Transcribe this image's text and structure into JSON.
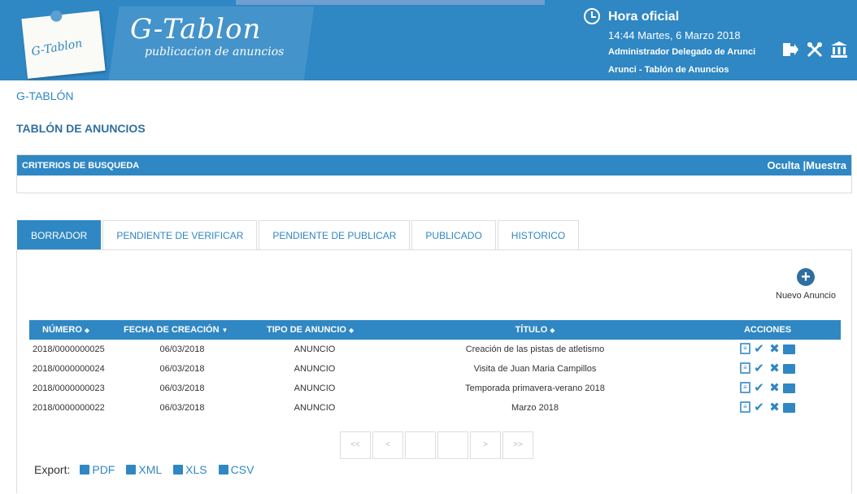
{
  "header": {
    "logo_text": "G-Tablon",
    "brand_title": "G-Tablon",
    "brand_subtitle": "publicacion de anuncios",
    "hora_title": "Hora oficial",
    "hora_time": "14:44 Martes, 6 Marzo 2018",
    "user": "Administrador Delegado de Arunci",
    "organization": "Arunci - Tablón de Anuncios",
    "icons": [
      "logout-icon",
      "tools-icon",
      "institution-icon"
    ]
  },
  "breadcrumb": "G-TABLÓN",
  "page_title": "TABLÓN DE ANUNCIOS",
  "criteria": {
    "label": "CRITERIOS DE BUSQUEDA",
    "toggle": "Oculta |Muestra"
  },
  "tabs": [
    {
      "label": "BORRADOR",
      "active": true
    },
    {
      "label": "PENDIENTE DE VERIFICAR",
      "active": false
    },
    {
      "label": "PENDIENTE DE PUBLICAR",
      "active": false
    },
    {
      "label": "PUBLICADO",
      "active": false
    },
    {
      "label": "HISTORICO",
      "active": false
    }
  ],
  "new_button": "Nuevo Anuncio",
  "table": {
    "columns": [
      "NÚMERO",
      "FECHA DE CREACIÓN",
      "TIPO DE ANUNCIO",
      "TÍTULO",
      "ACCIONES"
    ],
    "rows": [
      {
        "numero": "2018/0000000025",
        "fecha": "06/03/2018",
        "tipo": "ANUNCIO",
        "titulo": "Creación de las pistas de atletismo"
      },
      {
        "numero": "2018/0000000024",
        "fecha": "06/03/2018",
        "tipo": "ANUNCIO",
        "titulo": "Visita de Juan Maria Campillos"
      },
      {
        "numero": "2018/0000000023",
        "fecha": "06/03/2018",
        "tipo": "ANUNCIO",
        "titulo": "Temporada primavera-verano 2018"
      },
      {
        "numero": "2018/0000000022",
        "fecha": "06/03/2018",
        "tipo": "ANUNCIO",
        "titulo": "Marzo 2018"
      }
    ]
  },
  "pager": [
    "<<",
    "<",
    "",
    "",
    ">",
    ">>"
  ],
  "export": {
    "label": "Export:",
    "formats": [
      "PDF",
      "XML",
      "XLS",
      "CSV"
    ]
  },
  "colors": {
    "primary": "#2f87c4",
    "dark_primary": "#2f6fa0"
  }
}
